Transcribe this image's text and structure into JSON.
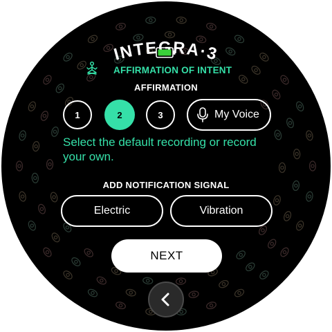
{
  "header": {
    "title": "INTEGRA·3",
    "subtitle": "AFFIRMATION OF INTENT"
  },
  "affirmation": {
    "label": "AFFIRMATION",
    "options": [
      "1",
      "2",
      "3"
    ],
    "selected": "2",
    "voice_label": "My Voice",
    "help_text": "Select the default recording or record your own."
  },
  "notification": {
    "label": "ADD NOTIFICATION SIGNAL",
    "options": [
      "Electric",
      "Vibration"
    ]
  },
  "footer": {
    "next_label": "NEXT"
  },
  "colors": {
    "accent": "#35e0a8",
    "background": "#000000",
    "battery": "#3ad23a"
  },
  "icons": {
    "battery": "battery-icon",
    "meditation": "meditation-icon",
    "microphone": "microphone-icon",
    "back": "chevron-left-icon"
  }
}
